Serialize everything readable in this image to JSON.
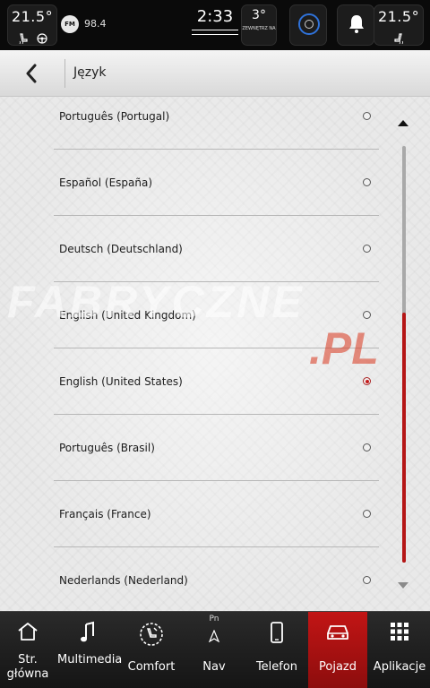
{
  "status_bar": {
    "left_temp": "21.5°",
    "right_temp": "21.5°",
    "radio_band": "FM",
    "radio_freq": "98.4",
    "time": "2:33",
    "outside_temp": "3°",
    "outside_label": "ZEWNĘTRZ NA"
  },
  "header": {
    "title": "Język"
  },
  "languages": [
    {
      "label": "Português (Portugal)",
      "selected": false
    },
    {
      "label": "Español (España)",
      "selected": false
    },
    {
      "label": "Deutsch (Deutschland)",
      "selected": false
    },
    {
      "label": "English (United Kingdom)",
      "selected": false
    },
    {
      "label": "English (United States)",
      "selected": true
    },
    {
      "label": "Português (Brasil)",
      "selected": false
    },
    {
      "label": "Français (France)",
      "selected": false
    },
    {
      "label": "Nederlands (Nederland)",
      "selected": false
    }
  ],
  "scroll": {
    "position": 0.2,
    "visible_fraction": 0.6
  },
  "watermark": {
    "text1": "FABRYCZNE",
    "text2": ".PL"
  },
  "bottom_nav": {
    "items": [
      {
        "label": "Str. główna",
        "icon": "home-icon"
      },
      {
        "label": "Multimedia",
        "icon": "music-note-icon"
      },
      {
        "label": "Comfort",
        "icon": "comfort-icon"
      },
      {
        "label": "Nav",
        "icon": "navigation-icon",
        "sub": "Pn"
      },
      {
        "label": "Telefon",
        "icon": "phone-icon"
      },
      {
        "label": "Pojazd",
        "icon": "car-icon",
        "active": true
      },
      {
        "label": "Aplikacje",
        "icon": "apps-grid-icon"
      }
    ]
  },
  "colors": {
    "accent": "#c51c1c",
    "selector_ring": "#2f72d9"
  }
}
